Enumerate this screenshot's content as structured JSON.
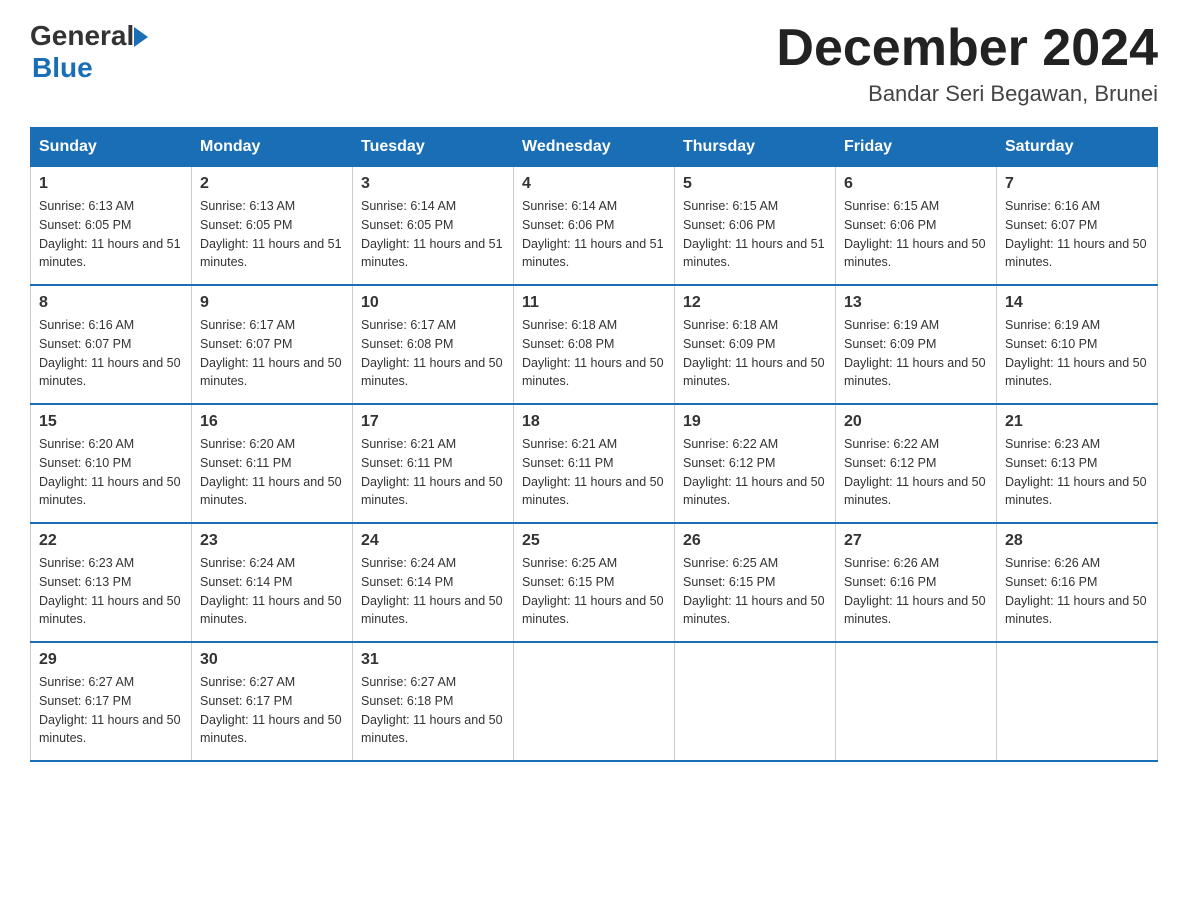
{
  "header": {
    "logo_general": "General",
    "logo_blue": "Blue",
    "month_title": "December 2024",
    "location": "Bandar Seri Begawan, Brunei"
  },
  "days_of_week": [
    "Sunday",
    "Monday",
    "Tuesday",
    "Wednesday",
    "Thursday",
    "Friday",
    "Saturday"
  ],
  "weeks": [
    [
      {
        "day": "1",
        "sunrise": "6:13 AM",
        "sunset": "6:05 PM",
        "daylight": "11 hours and 51 minutes."
      },
      {
        "day": "2",
        "sunrise": "6:13 AM",
        "sunset": "6:05 PM",
        "daylight": "11 hours and 51 minutes."
      },
      {
        "day": "3",
        "sunrise": "6:14 AM",
        "sunset": "6:05 PM",
        "daylight": "11 hours and 51 minutes."
      },
      {
        "day": "4",
        "sunrise": "6:14 AM",
        "sunset": "6:06 PM",
        "daylight": "11 hours and 51 minutes."
      },
      {
        "day": "5",
        "sunrise": "6:15 AM",
        "sunset": "6:06 PM",
        "daylight": "11 hours and 51 minutes."
      },
      {
        "day": "6",
        "sunrise": "6:15 AM",
        "sunset": "6:06 PM",
        "daylight": "11 hours and 50 minutes."
      },
      {
        "day": "7",
        "sunrise": "6:16 AM",
        "sunset": "6:07 PM",
        "daylight": "11 hours and 50 minutes."
      }
    ],
    [
      {
        "day": "8",
        "sunrise": "6:16 AM",
        "sunset": "6:07 PM",
        "daylight": "11 hours and 50 minutes."
      },
      {
        "day": "9",
        "sunrise": "6:17 AM",
        "sunset": "6:07 PM",
        "daylight": "11 hours and 50 minutes."
      },
      {
        "day": "10",
        "sunrise": "6:17 AM",
        "sunset": "6:08 PM",
        "daylight": "11 hours and 50 minutes."
      },
      {
        "day": "11",
        "sunrise": "6:18 AM",
        "sunset": "6:08 PM",
        "daylight": "11 hours and 50 minutes."
      },
      {
        "day": "12",
        "sunrise": "6:18 AM",
        "sunset": "6:09 PM",
        "daylight": "11 hours and 50 minutes."
      },
      {
        "day": "13",
        "sunrise": "6:19 AM",
        "sunset": "6:09 PM",
        "daylight": "11 hours and 50 minutes."
      },
      {
        "day": "14",
        "sunrise": "6:19 AM",
        "sunset": "6:10 PM",
        "daylight": "11 hours and 50 minutes."
      }
    ],
    [
      {
        "day": "15",
        "sunrise": "6:20 AM",
        "sunset": "6:10 PM",
        "daylight": "11 hours and 50 minutes."
      },
      {
        "day": "16",
        "sunrise": "6:20 AM",
        "sunset": "6:11 PM",
        "daylight": "11 hours and 50 minutes."
      },
      {
        "day": "17",
        "sunrise": "6:21 AM",
        "sunset": "6:11 PM",
        "daylight": "11 hours and 50 minutes."
      },
      {
        "day": "18",
        "sunrise": "6:21 AM",
        "sunset": "6:11 PM",
        "daylight": "11 hours and 50 minutes."
      },
      {
        "day": "19",
        "sunrise": "6:22 AM",
        "sunset": "6:12 PM",
        "daylight": "11 hours and 50 minutes."
      },
      {
        "day": "20",
        "sunrise": "6:22 AM",
        "sunset": "6:12 PM",
        "daylight": "11 hours and 50 minutes."
      },
      {
        "day": "21",
        "sunrise": "6:23 AM",
        "sunset": "6:13 PM",
        "daylight": "11 hours and 50 minutes."
      }
    ],
    [
      {
        "day": "22",
        "sunrise": "6:23 AM",
        "sunset": "6:13 PM",
        "daylight": "11 hours and 50 minutes."
      },
      {
        "day": "23",
        "sunrise": "6:24 AM",
        "sunset": "6:14 PM",
        "daylight": "11 hours and 50 minutes."
      },
      {
        "day": "24",
        "sunrise": "6:24 AM",
        "sunset": "6:14 PM",
        "daylight": "11 hours and 50 minutes."
      },
      {
        "day": "25",
        "sunrise": "6:25 AM",
        "sunset": "6:15 PM",
        "daylight": "11 hours and 50 minutes."
      },
      {
        "day": "26",
        "sunrise": "6:25 AM",
        "sunset": "6:15 PM",
        "daylight": "11 hours and 50 minutes."
      },
      {
        "day": "27",
        "sunrise": "6:26 AM",
        "sunset": "6:16 PM",
        "daylight": "11 hours and 50 minutes."
      },
      {
        "day": "28",
        "sunrise": "6:26 AM",
        "sunset": "6:16 PM",
        "daylight": "11 hours and 50 minutes."
      }
    ],
    [
      {
        "day": "29",
        "sunrise": "6:27 AM",
        "sunset": "6:17 PM",
        "daylight": "11 hours and 50 minutes."
      },
      {
        "day": "30",
        "sunrise": "6:27 AM",
        "sunset": "6:17 PM",
        "daylight": "11 hours and 50 minutes."
      },
      {
        "day": "31",
        "sunrise": "6:27 AM",
        "sunset": "6:18 PM",
        "daylight": "11 hours and 50 minutes."
      },
      null,
      null,
      null,
      null
    ]
  ]
}
